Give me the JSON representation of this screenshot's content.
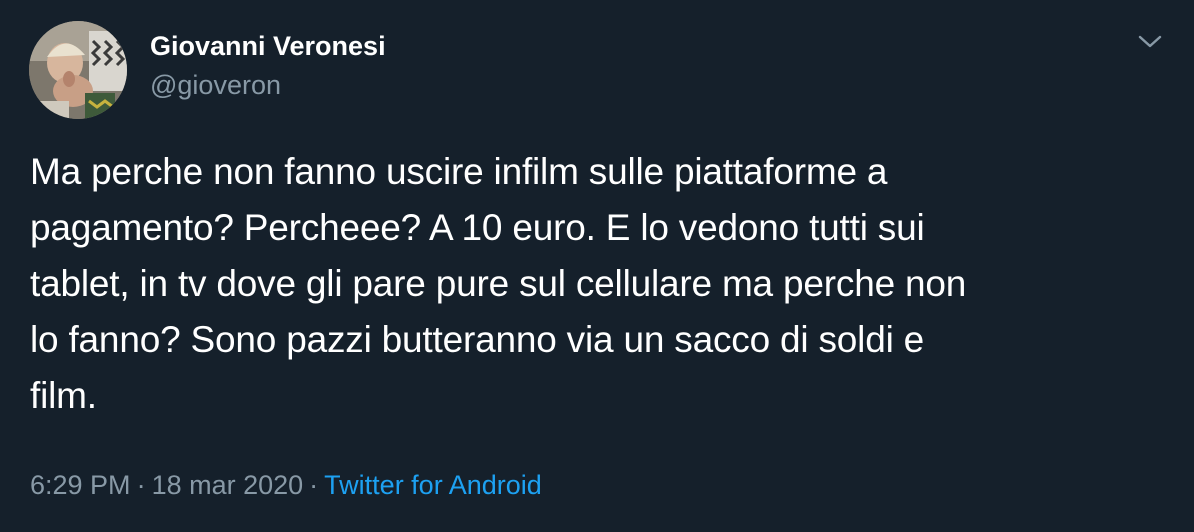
{
  "tweet": {
    "author_name": "Giovanni Veronesi",
    "author_handle": "@gioveron",
    "text": "Ma perche non fanno uscire infilm sulle piattaforme a\npagamento? Percheee? A 10 euro. E lo vedono tutti sui\ntablet, in tv dove gli pare pure sul cellulare ma perche non\nlo fanno? Sono pazzi butteranno via un sacco di soldi e\nfilm.",
    "time": "6:29 PM",
    "separator": "·",
    "date": "18 mar 2020",
    "source": "Twitter for Android"
  },
  "icons": {
    "menu": "chevron-down-icon",
    "avatar": "avatar"
  },
  "colors": {
    "background": "#15202b",
    "primary_text": "#ffffff",
    "secondary_text": "#8899a6",
    "link": "#1da1f2"
  }
}
